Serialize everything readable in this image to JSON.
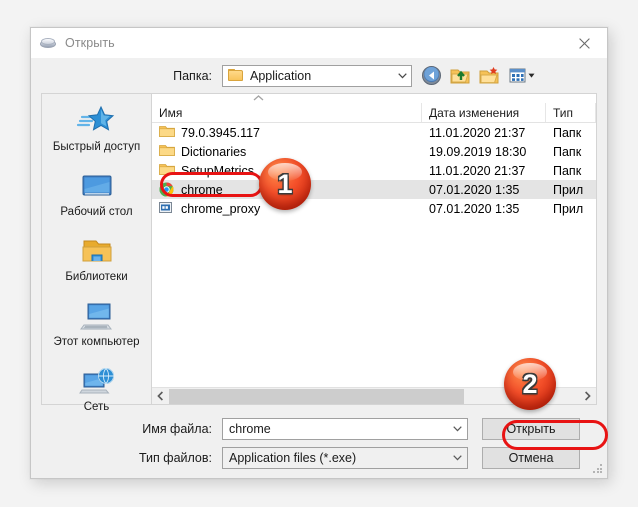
{
  "window": {
    "title": "Открыть",
    "title_icon": "disc-icon",
    "close_icon": "close-icon"
  },
  "toolbar": {
    "look_in_label": "Папка:",
    "current_folder": "Application",
    "folder_icon": "folder-icon",
    "dropdown_icon": "chevron-down-icon",
    "buttons": [
      {
        "name": "back-button",
        "icon": "back-arrow-icon"
      },
      {
        "name": "up-one-level-button",
        "icon": "folder-up-icon"
      },
      {
        "name": "new-folder-button",
        "icon": "new-folder-icon"
      },
      {
        "name": "views-button",
        "icon": "views-icon"
      }
    ]
  },
  "places": {
    "items": [
      {
        "label": "Быстрый доступ",
        "icon": "quick-access-star-icon"
      },
      {
        "label": "Рабочий стол",
        "icon": "desktop-icon"
      },
      {
        "label": "Библиотеки",
        "icon": "libraries-folder-icon"
      },
      {
        "label": "Этот компьютер",
        "icon": "this-pc-icon"
      },
      {
        "label": "Сеть",
        "icon": "network-icon"
      }
    ]
  },
  "file_list": {
    "sort_indicator": "sort-ascending-caret-icon",
    "columns": [
      "Имя",
      "Дата изменения",
      "Тип"
    ],
    "rows": [
      {
        "name": "79.0.3945.117",
        "date": "11.01.2020 21:37",
        "type": "Папк",
        "icon": "folder-icon",
        "selected": false
      },
      {
        "name": "Dictionaries",
        "date": "19.09.2019 18:30",
        "type": "Папк",
        "icon": "folder-icon",
        "selected": false
      },
      {
        "name": "SetupMetrics",
        "date": "11.01.2020 21:37",
        "type": "Папк",
        "icon": "folder-icon",
        "selected": false
      },
      {
        "name": "chrome",
        "date": "07.01.2020 1:35",
        "type": "Прил",
        "icon": "chrome-icon",
        "selected": true
      },
      {
        "name": "chrome_proxy",
        "date": "07.01.2020 1:35",
        "type": "Прил",
        "icon": "app-exe-icon",
        "selected": false
      }
    ],
    "scrollbar": {
      "left_icon": "chevron-left-icon",
      "right_icon": "chevron-right-icon",
      "thumb_width_percent": 72
    }
  },
  "form": {
    "file_name_label": "Имя файла:",
    "file_name_value": "chrome",
    "file_type_label": "Тип файлов:",
    "file_type_value": "Application files (*.exe)",
    "dropdown_icon": "chevron-down-icon",
    "open_button": "Открыть",
    "cancel_button": "Отмена"
  },
  "annotations": {
    "step_one": "1",
    "step_two": "2",
    "highlight_color": "#e81313"
  }
}
